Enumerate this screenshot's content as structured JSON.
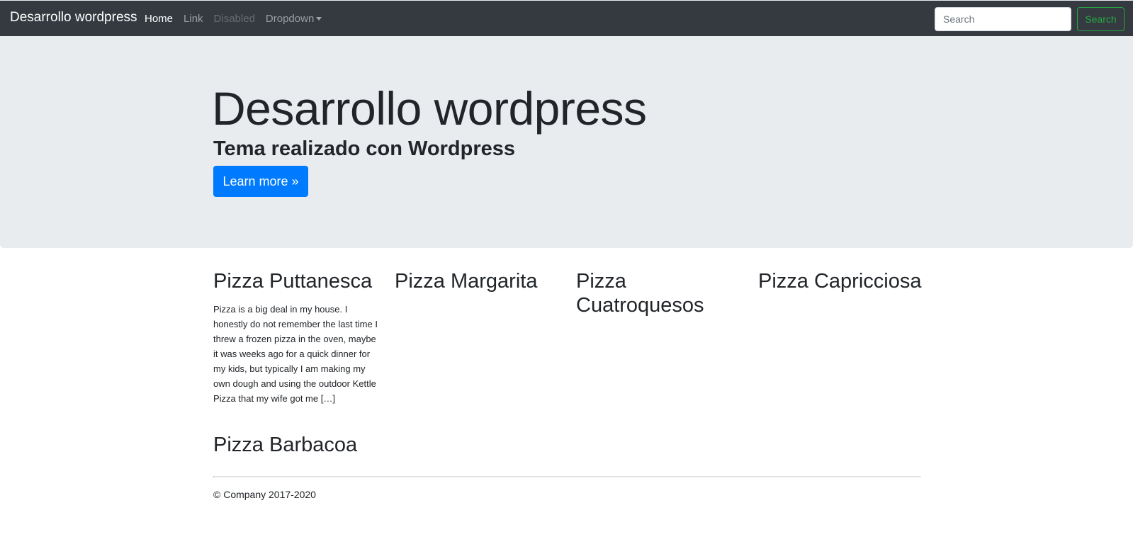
{
  "navbar": {
    "brand": "Desarrollo wordpress",
    "links": [
      {
        "label": "Home"
      },
      {
        "label": "Link"
      },
      {
        "label": "Disabled"
      },
      {
        "label": "Dropdown"
      }
    ],
    "search": {
      "placeholder": "Search",
      "button_label": "Search"
    },
    "colors": {
      "background": "#343a40",
      "search_accent": "#28a745"
    }
  },
  "hero": {
    "title": "Desarrollo wordpress",
    "subtitle": "Tema realizado con Wordpress",
    "button_label": "Learn more »",
    "colors": {
      "background": "#e9ecef",
      "button": "#007bff"
    }
  },
  "posts": [
    {
      "title": "Pizza Puttanesca",
      "excerpt": "Pizza is a big deal in my house. I honestly do not remember the last time I threw a frozen pizza in the oven, maybe it was weeks ago for a quick dinner for my kids, but typically I am making my own dough and using the outdoor Kettle Pizza that my wife got me […]"
    },
    {
      "title": "Pizza Margarita"
    },
    {
      "title": "Pizza Cuatroquesos"
    },
    {
      "title": "Pizza Capricciosa"
    },
    {
      "title": "Pizza Barbacoa"
    }
  ],
  "footer": {
    "text": "© Company 2017-2020"
  }
}
